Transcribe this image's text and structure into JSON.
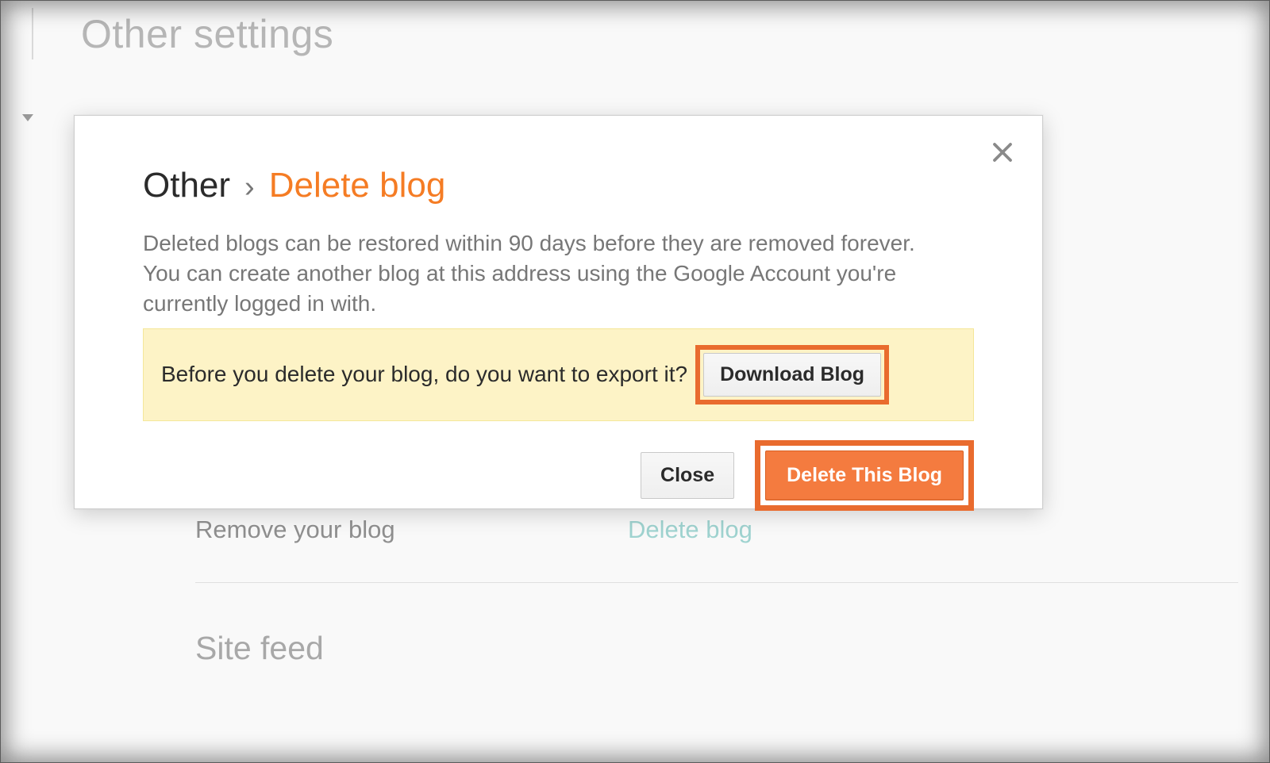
{
  "page": {
    "title": "Other settings",
    "section_heading": "Site feed"
  },
  "settings": {
    "remove_label": "Remove your blog",
    "delete_link": "Delete blog"
  },
  "modal": {
    "breadcrumb_root": "Other",
    "breadcrumb_sep": "›",
    "breadcrumb_leaf": "Delete blog",
    "description": "Deleted blogs can be restored within 90 days before they are removed forever. You can create another blog at this address using the Google Account you're currently logged in with.",
    "export_prompt": "Before you delete your blog, do you want to export it?",
    "download_button": "Download Blog",
    "close_button": "Close",
    "delete_button": "Delete This Blog"
  }
}
